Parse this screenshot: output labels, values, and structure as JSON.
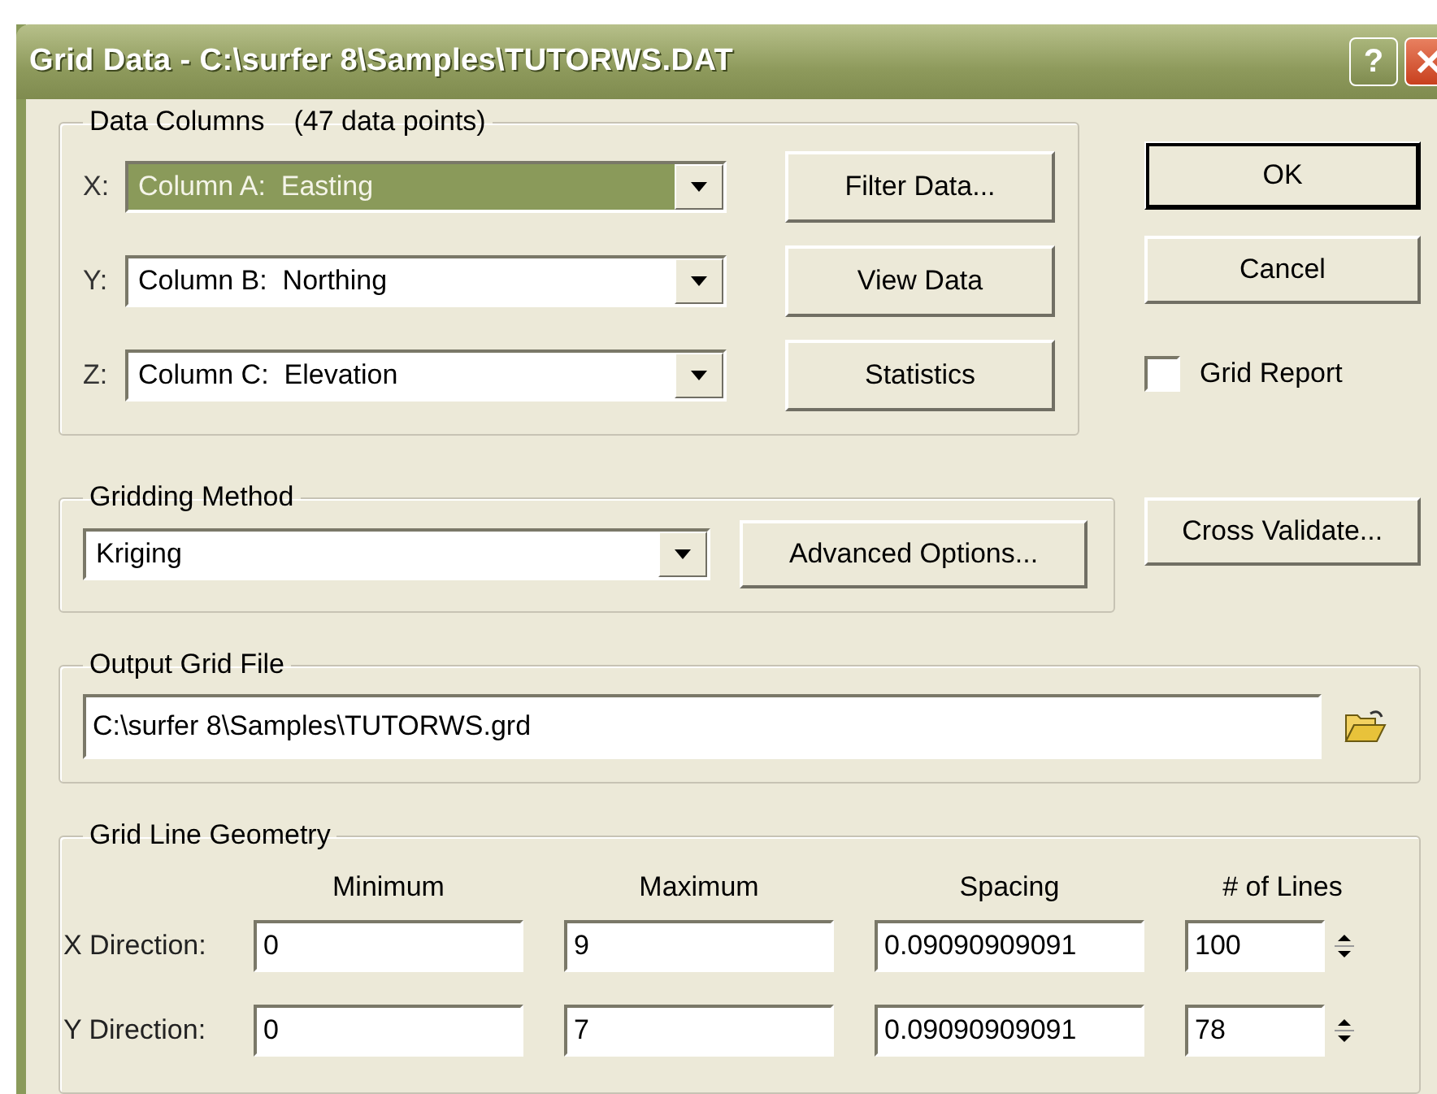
{
  "window": {
    "title": "Grid Data - C:\\surfer 8\\Samples\\TUTORWS.DAT",
    "help": "?"
  },
  "data_columns": {
    "title": "Data Columns",
    "count": "(47 data points)",
    "rows": [
      {
        "axis": "X:",
        "value": "Column A:  Easting",
        "selected": true,
        "button": "Filter Data..."
      },
      {
        "axis": "Y:",
        "value": "Column B:  Northing",
        "selected": false,
        "button": "View Data"
      },
      {
        "axis": "Z:",
        "value": "Column C:  Elevation",
        "selected": false,
        "button": "Statistics"
      }
    ]
  },
  "dialog_buttons": [
    {
      "label": "OK",
      "default": true
    },
    {
      "label": "Cancel",
      "default": false
    }
  ],
  "grid_report": {
    "label": "Grid Report",
    "checked": false
  },
  "gridding_method": {
    "title": "Gridding Method",
    "value": "Kriging",
    "button": "Advanced Options..."
  },
  "cross_validate": "Cross Validate...",
  "output_grid_file": {
    "title": "Output Grid File",
    "value": "C:\\surfer 8\\Samples\\TUTORWS.grd"
  },
  "grid_line_geometry": {
    "title": "Grid Line Geometry",
    "columns": [
      "Minimum",
      "Maximum",
      "Spacing",
      "# of Lines"
    ],
    "rows": [
      {
        "label": "X Direction:",
        "values": [
          "0",
          "9",
          "0.09090909091",
          "100"
        ]
      },
      {
        "label": "Y Direction:",
        "values": [
          "0",
          "7",
          "0.09090909091",
          "78"
        ]
      }
    ]
  }
}
